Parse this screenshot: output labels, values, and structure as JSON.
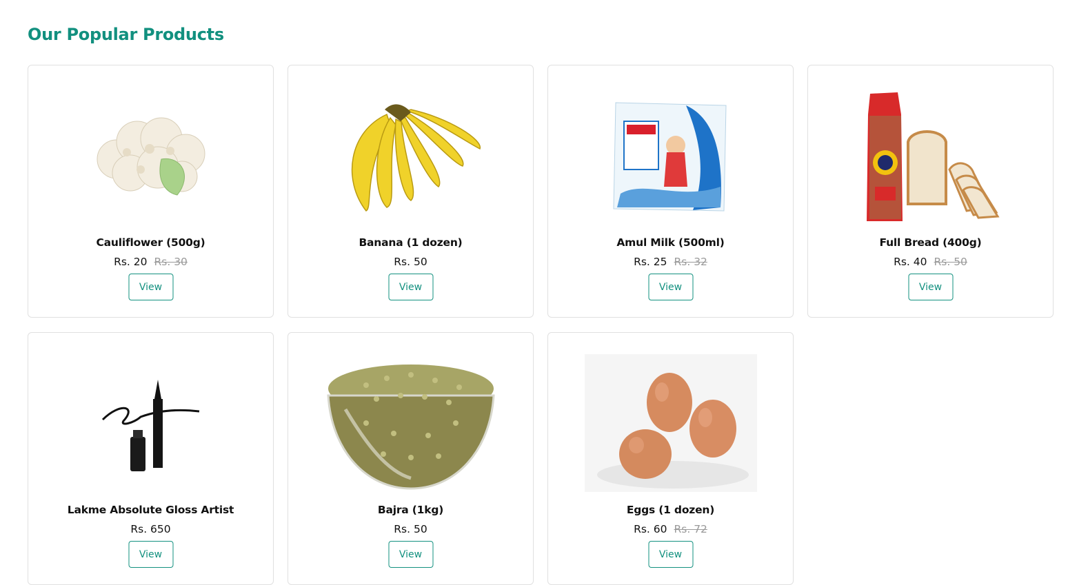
{
  "section": {
    "title": "Our Popular Products"
  },
  "products": [
    {
      "name": "Cauliflower (500g)",
      "price": "Rs. 20",
      "original_price": "Rs. 30",
      "view_label": "View",
      "icon": "cauliflower-icon"
    },
    {
      "name": "Banana (1 dozen)",
      "price": "Rs. 50",
      "original_price": "",
      "view_label": "View",
      "icon": "banana-icon"
    },
    {
      "name": "Amul Milk (500ml)",
      "price": "Rs. 25",
      "original_price": "Rs. 32",
      "view_label": "View",
      "icon": "milk-pack-icon"
    },
    {
      "name": "Full Bread (400g)",
      "price": "Rs. 40",
      "original_price": "Rs. 50",
      "view_label": "View",
      "icon": "bread-icon"
    },
    {
      "name": "Lakme Absolute Gloss Artist",
      "price": "Rs. 650",
      "original_price": "",
      "view_label": "View",
      "icon": "eyeliner-icon"
    },
    {
      "name": "Bajra (1kg)",
      "price": "Rs. 50",
      "original_price": "",
      "view_label": "View",
      "icon": "grain-bowl-icon"
    },
    {
      "name": "Eggs (1 dozen)",
      "price": "Rs. 60",
      "original_price": "Rs. 72",
      "view_label": "View",
      "icon": "eggs-icon"
    }
  ],
  "colors": {
    "accent": "#12907f",
    "old_price": "#9a9a9a",
    "card_border": "#e0e0e0"
  }
}
